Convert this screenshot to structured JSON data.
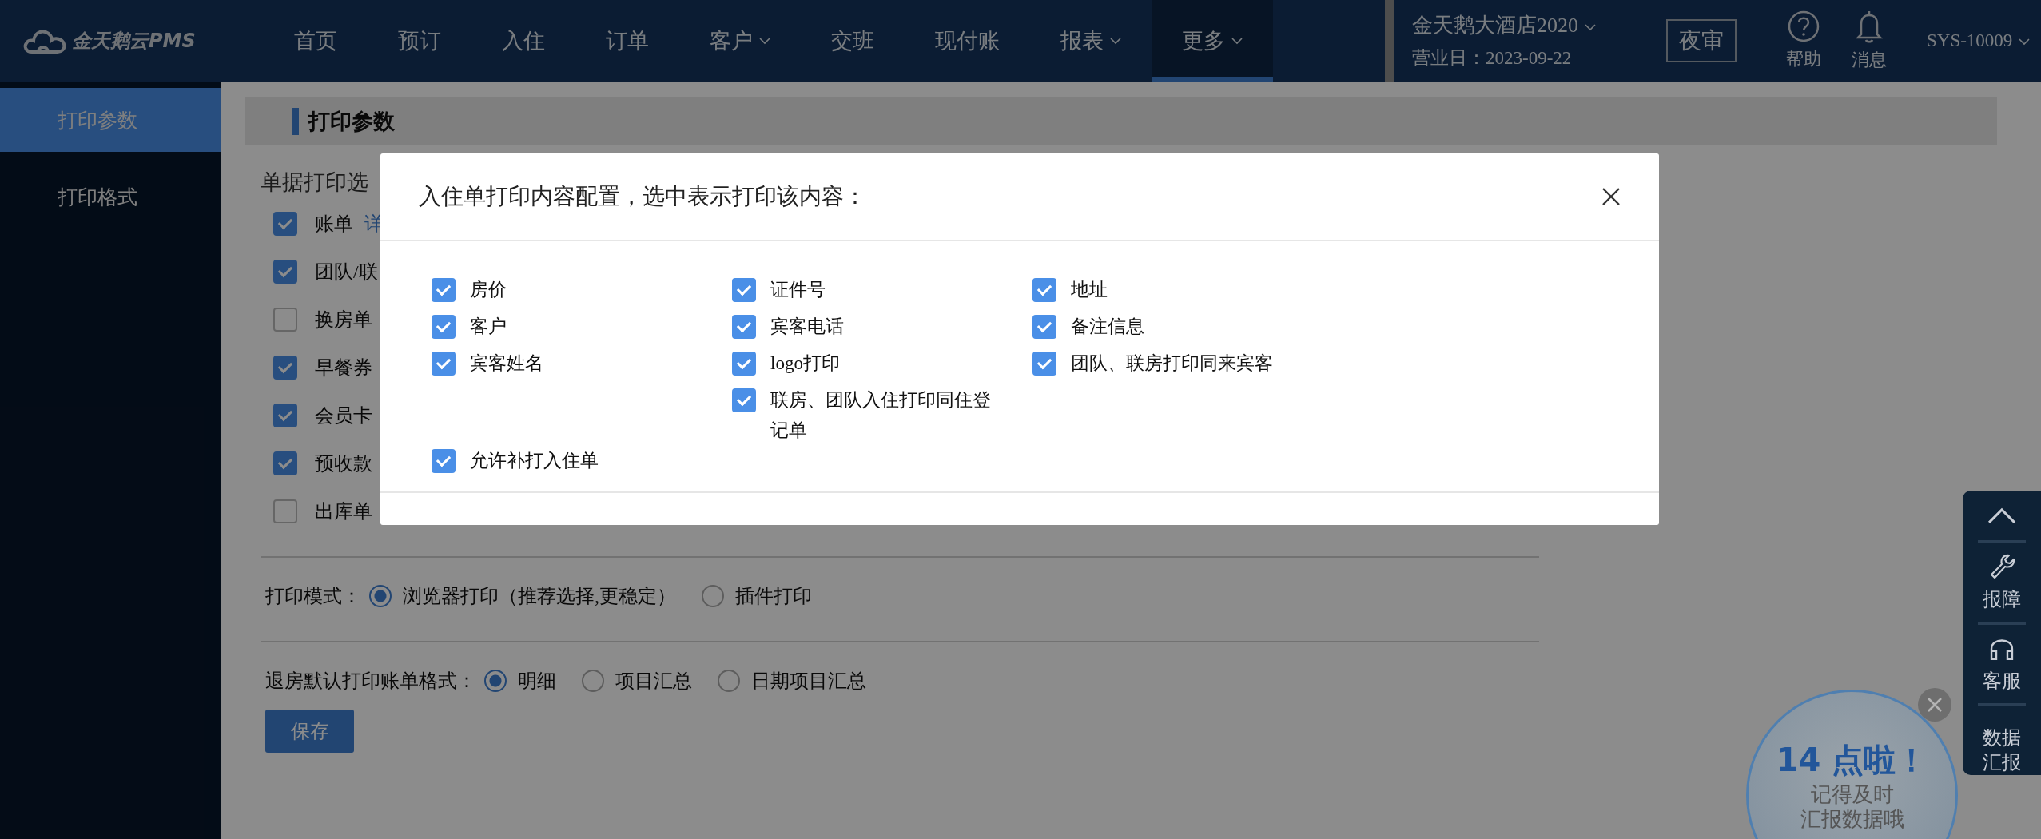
{
  "header": {
    "logo": "金天鹅云PMS",
    "nav": [
      {
        "label": "首页",
        "dropdown": false,
        "selected": false
      },
      {
        "label": "预订",
        "dropdown": false,
        "selected": false
      },
      {
        "label": "入住",
        "dropdown": false,
        "selected": false
      },
      {
        "label": "订单",
        "dropdown": false,
        "selected": false
      },
      {
        "label": "客户",
        "dropdown": true,
        "selected": false
      },
      {
        "label": "交班",
        "dropdown": false,
        "selected": false
      },
      {
        "label": "现付账",
        "dropdown": false,
        "selected": false
      },
      {
        "label": "报表",
        "dropdown": true,
        "selected": false
      },
      {
        "label": "更多",
        "dropdown": true,
        "selected": true
      }
    ],
    "hotel": "金天鹅大酒店2020",
    "business_date": "营业日：2023-09-22",
    "night_audit": "夜审",
    "help": "帮助",
    "messages": "消息",
    "user": "SYS-10009"
  },
  "sidebar": {
    "items": [
      {
        "label": "打印参数",
        "selected": true
      },
      {
        "label": "打印格式",
        "selected": false
      }
    ]
  },
  "content": {
    "title": "打印参数",
    "section_label": "单据打印选",
    "documents": [
      {
        "label": "账单",
        "checked": true,
        "link": "详"
      },
      {
        "label": "团队/联",
        "checked": true
      },
      {
        "label": "换房单",
        "checked": false
      },
      {
        "label": "早餐券",
        "checked": true
      },
      {
        "label": "会员卡",
        "checked": true
      },
      {
        "label": "预收款",
        "checked": true
      },
      {
        "label": "出库单",
        "checked": false
      }
    ],
    "print_mode": {
      "label": "打印模式：",
      "options": [
        {
          "label": "浏览器打印（推荐选择,更稳定）",
          "selected": true
        },
        {
          "label": "插件打印",
          "selected": false
        }
      ]
    },
    "checkout_format": {
      "label": "退房默认打印账单格式：",
      "options": [
        {
          "label": "明细",
          "selected": true
        },
        {
          "label": "项目汇总",
          "selected": false
        },
        {
          "label": "日期项目汇总",
          "selected": false
        }
      ]
    },
    "save_button": "保存"
  },
  "modal": {
    "title": "入住单打印内容配置，选中表示打印该内容：",
    "options": [
      {
        "label": "房价",
        "checked": true
      },
      {
        "label": "证件号",
        "checked": true
      },
      {
        "label": "地址",
        "checked": true
      },
      {
        "label": "客户",
        "checked": true
      },
      {
        "label": "宾客电话",
        "checked": true
      },
      {
        "label": "备注信息",
        "checked": true
      },
      {
        "label": "宾客姓名",
        "checked": true
      },
      {
        "label": "logo打印",
        "checked": true
      },
      {
        "label": "团队、联房打印同来宾客",
        "checked": true
      },
      {
        "label": "联房、团队入住打印同住登记单",
        "checked": true
      },
      {
        "label": "允许补打入住单",
        "checked": true
      }
    ]
  },
  "side_panel": {
    "items": [
      {
        "kind": "top"
      },
      {
        "kind": "wrench",
        "label": "报障"
      },
      {
        "kind": "headset",
        "label": "客服"
      },
      {
        "kind": "text",
        "label": "数据汇报"
      }
    ]
  },
  "reminder": {
    "headline": "14 点啦！",
    "message_lines": [
      "记得及时",
      "汇报数据哦"
    ]
  }
}
